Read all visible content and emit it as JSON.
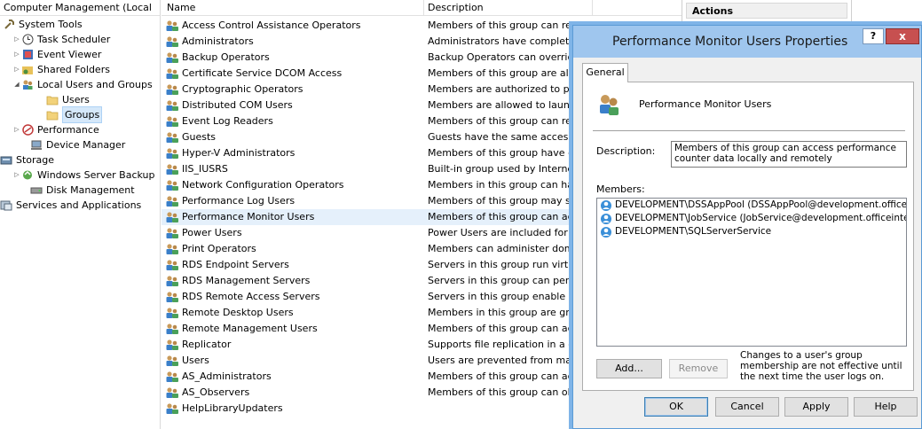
{
  "tree": {
    "root": "Computer Management (Local",
    "nodes": [
      {
        "label": "System Tools",
        "icon": "tools-icon"
      },
      {
        "label": "Task Scheduler",
        "icon": "clock-icon"
      },
      {
        "label": "Event Viewer",
        "icon": "event-viewer-icon"
      },
      {
        "label": "Shared Folders",
        "icon": "shared-folder-icon"
      },
      {
        "label": "Local Users and Groups",
        "icon": "users-icon"
      },
      {
        "label": "Users",
        "icon": "folder-icon"
      },
      {
        "label": "Groups",
        "icon": "folder-icon"
      },
      {
        "label": "Performance",
        "icon": "performance-icon"
      },
      {
        "label": "Device Manager",
        "icon": "device-manager-icon"
      },
      {
        "label": "Storage",
        "icon": "storage-icon"
      },
      {
        "label": "Windows Server Backup",
        "icon": "backup-icon"
      },
      {
        "label": "Disk Management",
        "icon": "disk-icon"
      },
      {
        "label": "Services and Applications",
        "icon": "services-icon"
      }
    ]
  },
  "list": {
    "columns": {
      "name": "Name",
      "description": "Description"
    },
    "rows": [
      {
        "name": "Access Control Assistance Operators",
        "desc": "Members of this group can rem"
      },
      {
        "name": "Administrators",
        "desc": "Administrators have complete a"
      },
      {
        "name": "Backup Operators",
        "desc": "Backup Operators can override s"
      },
      {
        "name": "Certificate Service DCOM Access",
        "desc": "Members of this group are allow"
      },
      {
        "name": "Cryptographic Operators",
        "desc": "Members are authorized to perfo"
      },
      {
        "name": "Distributed COM Users",
        "desc": "Members are allowed to launch,"
      },
      {
        "name": "Event Log Readers",
        "desc": "Members of this group can read"
      },
      {
        "name": "Guests",
        "desc": "Guests have the same access as"
      },
      {
        "name": "Hyper-V Administrators",
        "desc": "Members of this group have cor"
      },
      {
        "name": "IIS_IUSRS",
        "desc": "Built-in group used by Internet I"
      },
      {
        "name": "Network Configuration Operators",
        "desc": "Members in this group can have"
      },
      {
        "name": "Performance Log Users",
        "desc": "Members of this group may sch"
      },
      {
        "name": "Performance Monitor Users",
        "desc": "Members of this group can acce"
      },
      {
        "name": "Power Users",
        "desc": "Power Users are included for ba"
      },
      {
        "name": "Print Operators",
        "desc": "Members can administer domai"
      },
      {
        "name": "RDS Endpoint Servers",
        "desc": "Servers in this group run virtual"
      },
      {
        "name": "RDS Management Servers",
        "desc": "Servers in this group can perforr"
      },
      {
        "name": "RDS Remote Access Servers",
        "desc": "Servers in this group enable user"
      },
      {
        "name": "Remote Desktop Users",
        "desc": "Members in this group are grant"
      },
      {
        "name": "Remote Management Users",
        "desc": "Members of this group can acce"
      },
      {
        "name": "Replicator",
        "desc": "Supports file replication in a dor"
      },
      {
        "name": "Users",
        "desc": "Users are prevented from makin"
      },
      {
        "name": "AS_Administrators",
        "desc": "Members of this group can adm"
      },
      {
        "name": "AS_Observers",
        "desc": "Members of this group can obse"
      },
      {
        "name": "HelpLibraryUpdaters",
        "desc": ""
      }
    ]
  },
  "actions": {
    "header": "Actions"
  },
  "dialog": {
    "title": "Performance Monitor Users Properties",
    "help_label": "?",
    "close_label": "x",
    "tab_label": "General",
    "group_name": "Performance Monitor Users",
    "description_label": "Description:",
    "description_value": "Members of this group can access performance counter data locally and remotely",
    "members_label": "Members:",
    "members": [
      "DEVELOPMENT\\DSSAppPool (DSSAppPool@development.officei...",
      "DEVELOPMENT\\JobService (JobService@development.officeinte...",
      "DEVELOPMENT\\SQLServerService"
    ],
    "add_label": "Add...",
    "remove_label": "Remove",
    "note": "Changes to a user's group membership are not effective until the next time the user logs on.",
    "ok_label": "OK",
    "cancel_label": "Cancel",
    "apply_label": "Apply",
    "help_button_label": "Help"
  },
  "colors": {
    "title_bar": "#9fc6ee",
    "close_button": "#c75050",
    "selection": "#e5f0fb"
  }
}
